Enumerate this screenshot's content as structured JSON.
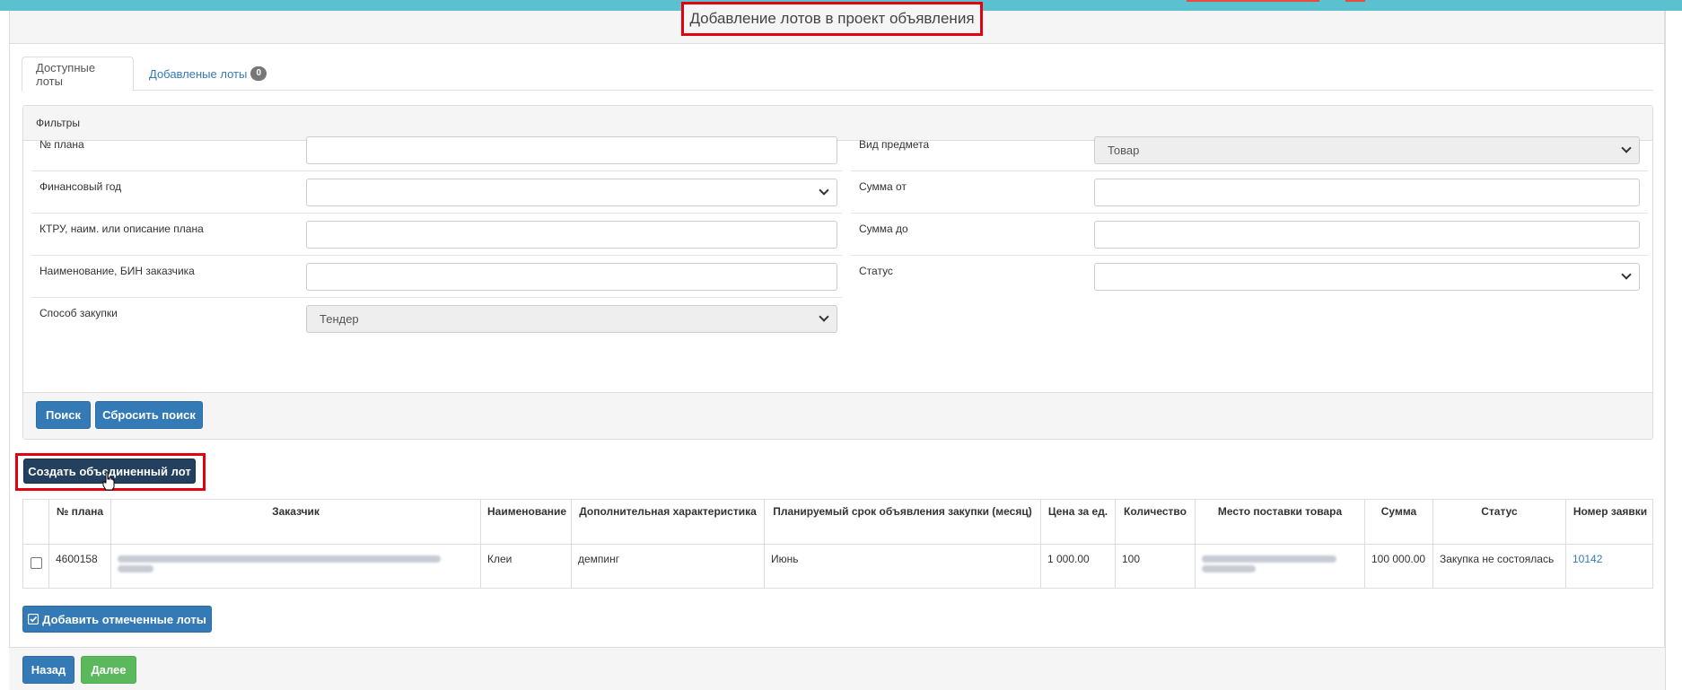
{
  "page": {
    "title": "Добавление лотов в проект объявления"
  },
  "tabs": [
    {
      "label": "Доступные лоты",
      "active": true
    },
    {
      "label": "Добавленые лоты",
      "badge": "0",
      "active": false
    }
  ],
  "filters": {
    "heading": "Фильтры",
    "left": [
      {
        "label": "№ плана",
        "value": "",
        "type": "input"
      },
      {
        "label": "Финансовый год",
        "value": "",
        "type": "select"
      },
      {
        "label": "КТРУ, наим. или описание плана",
        "value": "",
        "type": "input"
      },
      {
        "label": "Наименование, БИН заказчика",
        "value": "",
        "type": "input"
      },
      {
        "label": "Способ закупки",
        "value": "Тендер",
        "type": "select",
        "disabled": true
      }
    ],
    "right": [
      {
        "label": "Вид предмета",
        "value": "Товар",
        "type": "select",
        "disabled": true
      },
      {
        "label": "Сумма от",
        "value": "",
        "type": "input"
      },
      {
        "label": "Сумма до",
        "value": "",
        "type": "input"
      },
      {
        "label": "Статус",
        "value": "",
        "type": "select"
      }
    ],
    "search_label": "Поиск",
    "reset_label": "Сбросить поиск"
  },
  "actions": {
    "create_merged_lot": "Создать объединенный лот",
    "add_checked_lots": "Добавить отмеченные лоты"
  },
  "table": {
    "headers": [
      "№ плана",
      "Заказчик",
      "Наименование",
      "Дополнительная характеристика",
      "Планируемый срок объявления закупки (месяц)",
      "Цена за ед.",
      "Количество",
      "Место поставки товара",
      "Сумма",
      "Статус",
      "Номер заявки"
    ],
    "rows": [
      {
        "plan_no": "4600158",
        "customer": "",
        "name": "Клеи",
        "extra": "демпинг",
        "month": "Июнь",
        "unit_price": "1 000.00",
        "quantity": "100",
        "delivery_place": "",
        "sum": "100 000.00",
        "status": "Закупка не состоялась",
        "request_no": "10142"
      }
    ]
  },
  "footer": {
    "back_label": "Назад",
    "next_label": "Далее"
  },
  "colors": {
    "accent": "#337ab7",
    "highlight": "#e3000f",
    "topbar": "#5bc0cf"
  }
}
